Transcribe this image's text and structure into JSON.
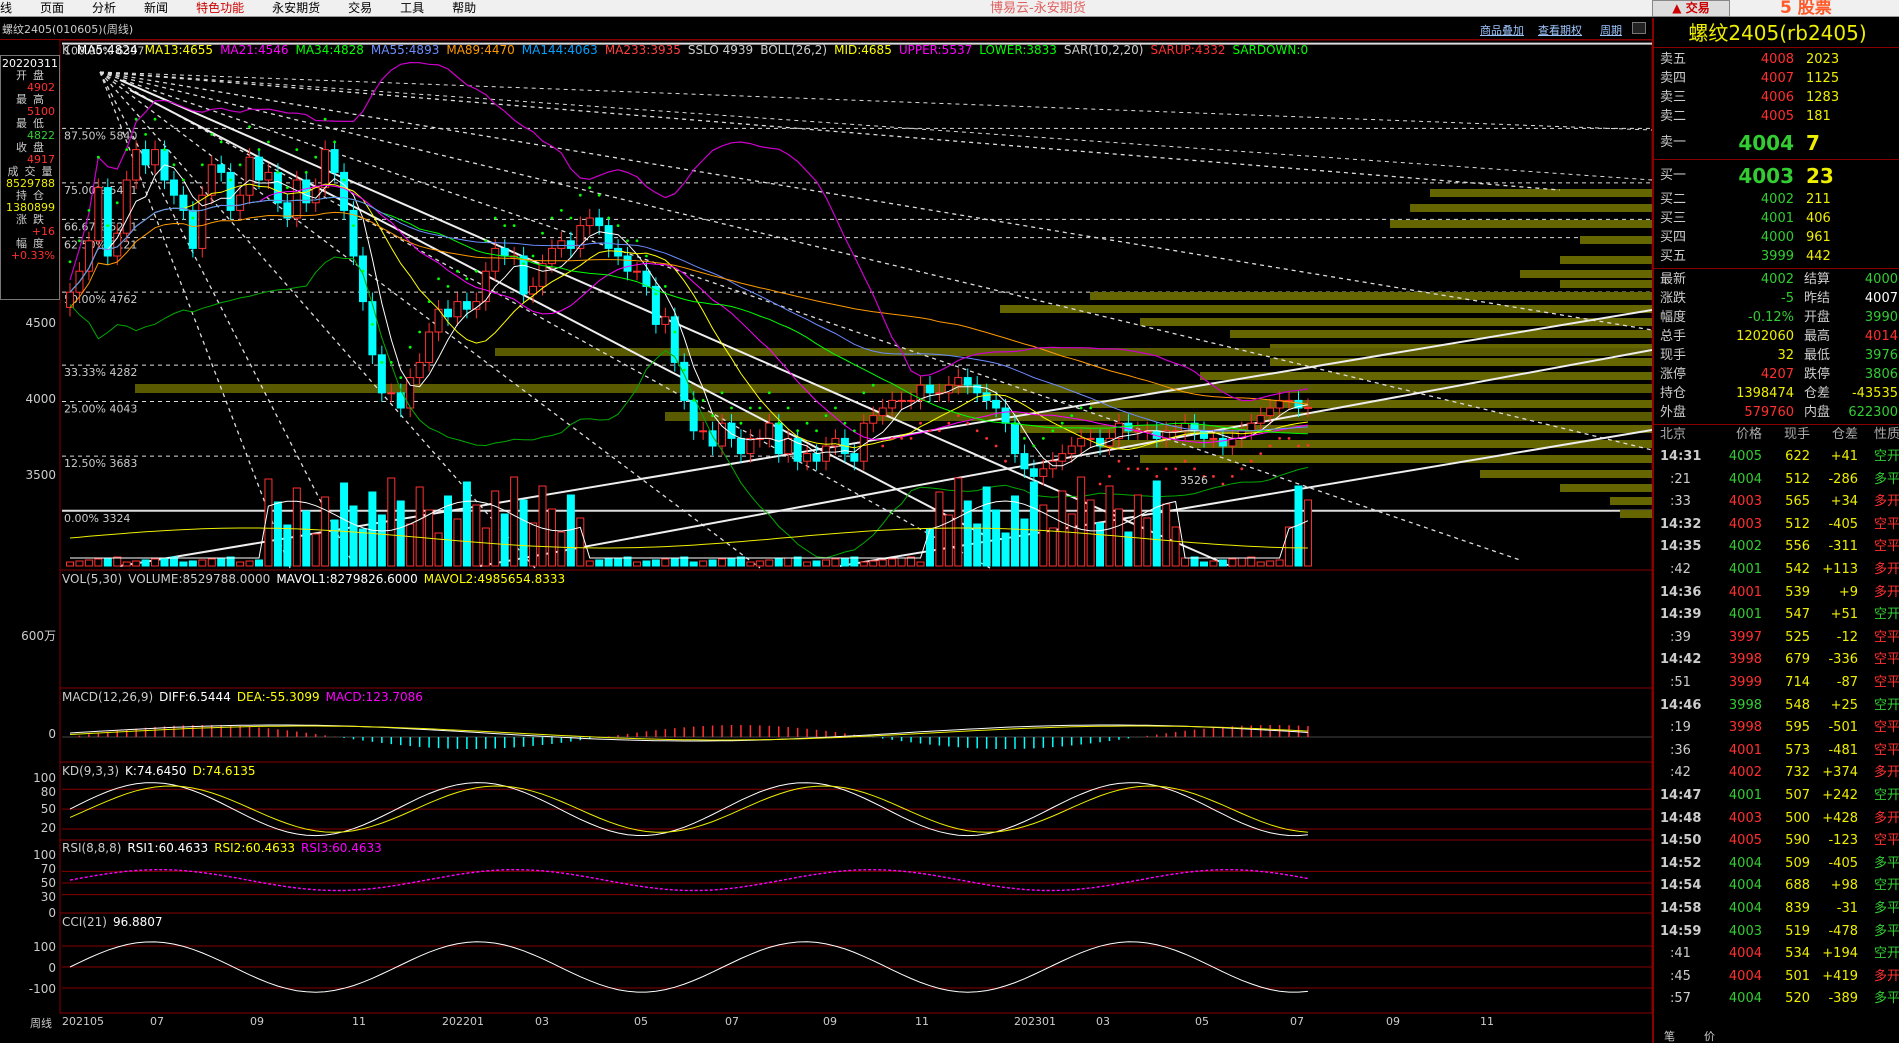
{
  "menu": [
    "线",
    "页面",
    "分析",
    "新闻",
    "特色功能",
    "永安期货",
    "交易",
    "工具",
    "帮助"
  ],
  "menu_active_index": 4,
  "app_title": "博易云-永安期货",
  "trade_button": "▲ 交易",
  "watermark": "5 股票5etz.com",
  "chart_title": "螺纹2405(010605)(周线)",
  "toplinks": [
    "商品叠加",
    "查看期权",
    "周期"
  ],
  "left_panel": {
    "date": "20220311",
    "rows": [
      {
        "label": "开盘",
        "value": "4902",
        "color": "red"
      },
      {
        "label": "最高",
        "value": "5100",
        "color": "red"
      },
      {
        "label": "最低",
        "value": "4822",
        "color": "green"
      },
      {
        "label": "收盘",
        "value": "4917",
        "color": "red"
      },
      {
        "label": "成交量",
        "value": "8529788",
        "color": "yellow"
      },
      {
        "label": "持仓",
        "value": "1380899",
        "color": "yellow"
      },
      {
        "label": "涨跌",
        "value": "+16",
        "color": "red"
      },
      {
        "label": "幅度",
        "value": "+0.33%",
        "color": "red"
      }
    ]
  },
  "legend": [
    {
      "text": "K",
      "color": "#cccccc"
    },
    {
      "text": "MA5:4824",
      "color": "#ffffff"
    },
    {
      "text": "MA13:4655",
      "color": "#ffff00"
    },
    {
      "text": "MA21:4546",
      "color": "#ff00ff"
    },
    {
      "text": "MA34:4828",
      "color": "#00ff00"
    },
    {
      "text": "MA55:4893",
      "color": "#6c8cff"
    },
    {
      "text": "MA89:4470",
      "color": "#ff9900"
    },
    {
      "text": "MA144:4063",
      "color": "#00a0ff"
    },
    {
      "text": "MA233:3935",
      "color": "#ff4040"
    },
    {
      "text": "SSLO 4939",
      "color": "#cccccc"
    },
    {
      "text": "BOLL(26,2)",
      "color": "#cccccc"
    },
    {
      "text": "MID:4685",
      "color": "#ffff00"
    },
    {
      "text": "UPPER:5537",
      "color": "#ff00ff"
    },
    {
      "text": "LOWER:3833",
      "color": "#00ff00"
    },
    {
      "text": "SAR(10,2,20)",
      "color": "#cccccc"
    },
    {
      "text": "SARUP:4332",
      "color": "#ff3030"
    },
    {
      "text": "SARDOWN:0",
      "color": "#00ff00"
    }
  ],
  "price_axis": [
    "4500",
    "4000",
    "3500"
  ],
  "fib_levels": [
    {
      "label": "100.00%",
      "value": "6397"
    },
    {
      "label": "87.50%",
      "value": "5840"
    },
    {
      "label": "75.00%",
      "value": "5481"
    },
    {
      "label": "66.67%",
      "value": "5241"
    },
    {
      "label": "62.50%",
      "value": "5121"
    },
    {
      "label": "50.00%",
      "value": "4762"
    },
    {
      "label": "33.33%",
      "value": "4282"
    },
    {
      "label": "25.00%",
      "value": "4043"
    },
    {
      "label": "12.50%",
      "value": "3683"
    },
    {
      "label": "0.00%",
      "value": "3324"
    }
  ],
  "low_marker": "3526",
  "vol_label": [
    {
      "text": "VOL(5,30)",
      "color": "#cccccc"
    },
    {
      "text": "VOLUME:8529788.0000",
      "color": "#cccccc"
    },
    {
      "text": "MAVOL1:8279826.6000",
      "color": "#ffffff"
    },
    {
      "text": "MAVOL2:4985654.8333",
      "color": "#ffff00"
    }
  ],
  "vol_axis": [
    "600万"
  ],
  "macd_label": [
    {
      "text": "MACD(12,26,9)",
      "color": "#cccccc"
    },
    {
      "text": "DIFF:6.5444",
      "color": "#ffffff"
    },
    {
      "text": "DEA:-55.3099",
      "color": "#ffff00"
    },
    {
      "text": "MACD:123.7086",
      "color": "#ff00ff"
    }
  ],
  "macd_axis": [
    "0"
  ],
  "kd_label": [
    {
      "text": "KD(9,3,3)",
      "color": "#cccccc"
    },
    {
      "text": "K:74.6450",
      "color": "#ffffff"
    },
    {
      "text": "D:74.6135",
      "color": "#ffff00"
    }
  ],
  "kd_axis": [
    "100",
    "80",
    "50",
    "20"
  ],
  "rsi_label": [
    {
      "text": "RSI(8,8,8)",
      "color": "#cccccc"
    },
    {
      "text": "RSI1:60.4633",
      "color": "#ffffff"
    },
    {
      "text": "RSI2:60.4633",
      "color": "#ffff00"
    },
    {
      "text": "RSI3:60.4633",
      "color": "#ff00ff"
    }
  ],
  "rsi_axis": [
    "100",
    "70",
    "50",
    "30",
    "0"
  ],
  "cci_label": [
    {
      "text": "CCI(21)",
      "color": "#cccccc"
    },
    {
      "text": "96.8807",
      "color": "#ffffff"
    }
  ],
  "cci_axis": [
    "100",
    "0",
    "-100"
  ],
  "x_axis": [
    "周线",
    "202105",
    "07",
    "09",
    "11",
    "202201",
    "03",
    "05",
    "07",
    "09",
    "11",
    "202301",
    "03",
    "05",
    "07",
    "09",
    "11"
  ],
  "right": {
    "symbol": "螺纹2405(rb2405)",
    "asks": [
      {
        "label": "卖五",
        "price": "4008",
        "vol": "2023"
      },
      {
        "label": "卖四",
        "price": "4007",
        "vol": "1125"
      },
      {
        "label": "卖三",
        "price": "4006",
        "vol": "1283"
      },
      {
        "label": "卖二",
        "price": "4005",
        "vol": "181"
      },
      {
        "label": "卖一",
        "price": "4004",
        "vol": "7"
      }
    ],
    "bids": [
      {
        "label": "买一",
        "price": "4003",
        "vol": "23"
      },
      {
        "label": "买二",
        "price": "4002",
        "vol": "211"
      },
      {
        "label": "买三",
        "price": "4001",
        "vol": "406"
      },
      {
        "label": "买四",
        "price": "4000",
        "vol": "961"
      },
      {
        "label": "买五",
        "price": "3999",
        "vol": "442"
      }
    ],
    "quotes": [
      {
        "l1": "最新",
        "v1": "4002",
        "c1": "green",
        "l2": "结算",
        "v2": "4000",
        "c2": "green"
      },
      {
        "l1": "涨跌",
        "v1": "-5",
        "c1": "green",
        "l2": "昨结",
        "v2": "4007",
        "c2": "white"
      },
      {
        "l1": "幅度",
        "v1": "-0.12%",
        "c1": "green",
        "l2": "开盘",
        "v2": "3990",
        "c2": "green"
      },
      {
        "l1": "总手",
        "v1": "1202060",
        "c1": "yellow",
        "l2": "最高",
        "v2": "4014",
        "c2": "red"
      },
      {
        "l1": "现手",
        "v1": "32",
        "c1": "yellow",
        "l2": "最低",
        "v2": "3976",
        "c2": "green"
      },
      {
        "l1": "涨停",
        "v1": "4207",
        "c1": "red",
        "l2": "跌停",
        "v2": "3806",
        "c2": "green"
      },
      {
        "l1": "持仓",
        "v1": "1398474",
        "c1": "yellow",
        "l2": "仓差",
        "v2": "-43535",
        "c2": "yellow"
      },
      {
        "l1": "外盘",
        "v1": "579760",
        "c1": "red",
        "l2": "内盘",
        "v2": "622300",
        "c2": "green"
      }
    ],
    "tick_header": [
      "北京",
      "价格",
      "现手",
      "仓差",
      "性质"
    ],
    "ticks": [
      {
        "t": "14:31",
        "s": false,
        "p": "4005",
        "pc": "green",
        "q": "622",
        "x": "+41",
        "xc": "yellow",
        "k": "空开",
        "kc": "green"
      },
      {
        "t": ":21",
        "s": true,
        "p": "4004",
        "pc": "green",
        "q": "512",
        "x": "-286",
        "xc": "yellow",
        "k": "多平",
        "kc": "green"
      },
      {
        "t": ":33",
        "s": true,
        "p": "4003",
        "pc": "red",
        "q": "565",
        "x": "+34",
        "xc": "yellow",
        "k": "多开",
        "kc": "red"
      },
      {
        "t": "14:32",
        "s": false,
        "p": "4003",
        "pc": "red",
        "q": "512",
        "x": "-405",
        "xc": "yellow",
        "k": "空平",
        "kc": "red"
      },
      {
        "t": "14:35",
        "s": false,
        "p": "4002",
        "pc": "green",
        "q": "556",
        "x": "-311",
        "xc": "yellow",
        "k": "空平",
        "kc": "red"
      },
      {
        "t": ":42",
        "s": true,
        "p": "4001",
        "pc": "green",
        "q": "542",
        "x": "+113",
        "xc": "yellow",
        "k": "多开",
        "kc": "red"
      },
      {
        "t": "14:36",
        "s": false,
        "p": "4001",
        "pc": "red",
        "q": "539",
        "x": "+9",
        "xc": "yellow",
        "k": "多开",
        "kc": "red"
      },
      {
        "t": "14:39",
        "s": false,
        "p": "4001",
        "pc": "green",
        "q": "547",
        "x": "+51",
        "xc": "yellow",
        "k": "空开",
        "kc": "green"
      },
      {
        "t": ":39",
        "s": true,
        "p": "3997",
        "pc": "red",
        "q": "525",
        "x": "-12",
        "xc": "yellow",
        "k": "空平",
        "kc": "red"
      },
      {
        "t": "14:42",
        "s": false,
        "p": "3998",
        "pc": "red",
        "q": "679",
        "x": "-336",
        "xc": "yellow",
        "k": "空平",
        "kc": "red"
      },
      {
        "t": ":51",
        "s": true,
        "p": "3999",
        "pc": "red",
        "q": "714",
        "x": "-87",
        "xc": "yellow",
        "k": "空平",
        "kc": "red"
      },
      {
        "t": "14:46",
        "s": false,
        "p": "3998",
        "pc": "green",
        "q": "548",
        "x": "+25",
        "xc": "yellow",
        "k": "空开",
        "kc": "green"
      },
      {
        "t": ":19",
        "s": true,
        "p": "3998",
        "pc": "red",
        "q": "595",
        "x": "-501",
        "xc": "yellow",
        "k": "空平",
        "kc": "red"
      },
      {
        "t": ":36",
        "s": true,
        "p": "4001",
        "pc": "red",
        "q": "573",
        "x": "-481",
        "xc": "yellow",
        "k": "空平",
        "kc": "red"
      },
      {
        "t": ":42",
        "s": true,
        "p": "4002",
        "pc": "red",
        "q": "732",
        "x": "+374",
        "xc": "yellow",
        "k": "多开",
        "kc": "red"
      },
      {
        "t": "14:47",
        "s": false,
        "p": "4001",
        "pc": "green",
        "q": "507",
        "x": "+242",
        "xc": "yellow",
        "k": "空开",
        "kc": "green"
      },
      {
        "t": "14:48",
        "s": false,
        "p": "4003",
        "pc": "red",
        "q": "500",
        "x": "+428",
        "xc": "yellow",
        "k": "多开",
        "kc": "red"
      },
      {
        "t": "14:50",
        "s": false,
        "p": "4005",
        "pc": "red",
        "q": "590",
        "x": "-123",
        "xc": "yellow",
        "k": "空平",
        "kc": "red"
      },
      {
        "t": "14:52",
        "s": false,
        "p": "4004",
        "pc": "green",
        "q": "509",
        "x": "-405",
        "xc": "yellow",
        "k": "多平",
        "kc": "green"
      },
      {
        "t": "14:54",
        "s": false,
        "p": "4004",
        "pc": "green",
        "q": "688",
        "x": "+98",
        "xc": "yellow",
        "k": "空开",
        "kc": "green"
      },
      {
        "t": "14:58",
        "s": false,
        "p": "4004",
        "pc": "green",
        "q": "839",
        "x": "-31",
        "xc": "yellow",
        "k": "多平",
        "kc": "green"
      },
      {
        "t": "14:59",
        "s": false,
        "p": "4003",
        "pc": "green",
        "q": "519",
        "x": "-478",
        "xc": "yellow",
        "k": "多平",
        "kc": "green"
      },
      {
        "t": ":41",
        "s": true,
        "p": "4004",
        "pc": "red",
        "q": "534",
        "x": "+194",
        "xc": "yellow",
        "k": "空开",
        "kc": "green"
      },
      {
        "t": ":45",
        "s": true,
        "p": "4004",
        "pc": "red",
        "q": "501",
        "x": "+419",
        "xc": "yellow",
        "k": "多开",
        "kc": "red"
      },
      {
        "t": ":57",
        "s": true,
        "p": "4004",
        "pc": "green",
        "q": "520",
        "x": "-389",
        "xc": "yellow",
        "k": "多平",
        "kc": "green"
      }
    ],
    "bottom_tabs": [
      "笔",
      "价"
    ]
  },
  "colors": {
    "up": "#ff3030",
    "down": "#00ffff",
    "bg": "#000000",
    "grid": "#800000"
  }
}
